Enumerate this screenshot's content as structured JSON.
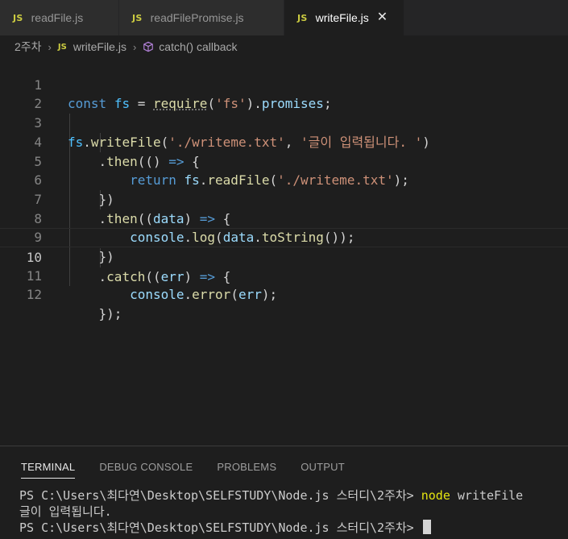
{
  "tabs": [
    {
      "badge": "JS",
      "label": "readFile.js",
      "active": false
    },
    {
      "badge": "JS",
      "label": "readFilePromise.js",
      "active": false
    },
    {
      "badge": "JS",
      "label": "writeFile.js",
      "active": true,
      "close": "✕"
    }
  ],
  "breadcrumb": {
    "folder": "2주차",
    "sep": "›",
    "file_badge": "JS",
    "file": "writeFile.js",
    "symbol": "catch() callback"
  },
  "editor": {
    "line_numbers": [
      "1",
      "2",
      "3",
      "4",
      "5",
      "6",
      "7",
      "8",
      "9",
      "10",
      "11",
      "12"
    ],
    "active_line": "10"
  },
  "panel": {
    "tabs": [
      "TERMINAL",
      "DEBUG CONSOLE",
      "PROBLEMS",
      "OUTPUT"
    ],
    "active_tab": "TERMINAL"
  },
  "terminal": {
    "prompt1": "PS C:\\Users\\최다연\\Desktop\\SELFSTUDY\\Node.js 스터디\\2주차> ",
    "cmd_node": "node",
    "cmd_arg": " writeFile",
    "output": "글이 입력됩니다.",
    "prompt2": "PS C:\\Users\\최다연\\Desktop\\SELFSTUDY\\Node.js 스터디\\2주차> "
  },
  "colors": {
    "js_badge": "#cbcb41",
    "keyword": "#569cd6",
    "string": "#ce9178",
    "function": "#dcdcaa",
    "terminal_cmd": "#e5e510"
  }
}
